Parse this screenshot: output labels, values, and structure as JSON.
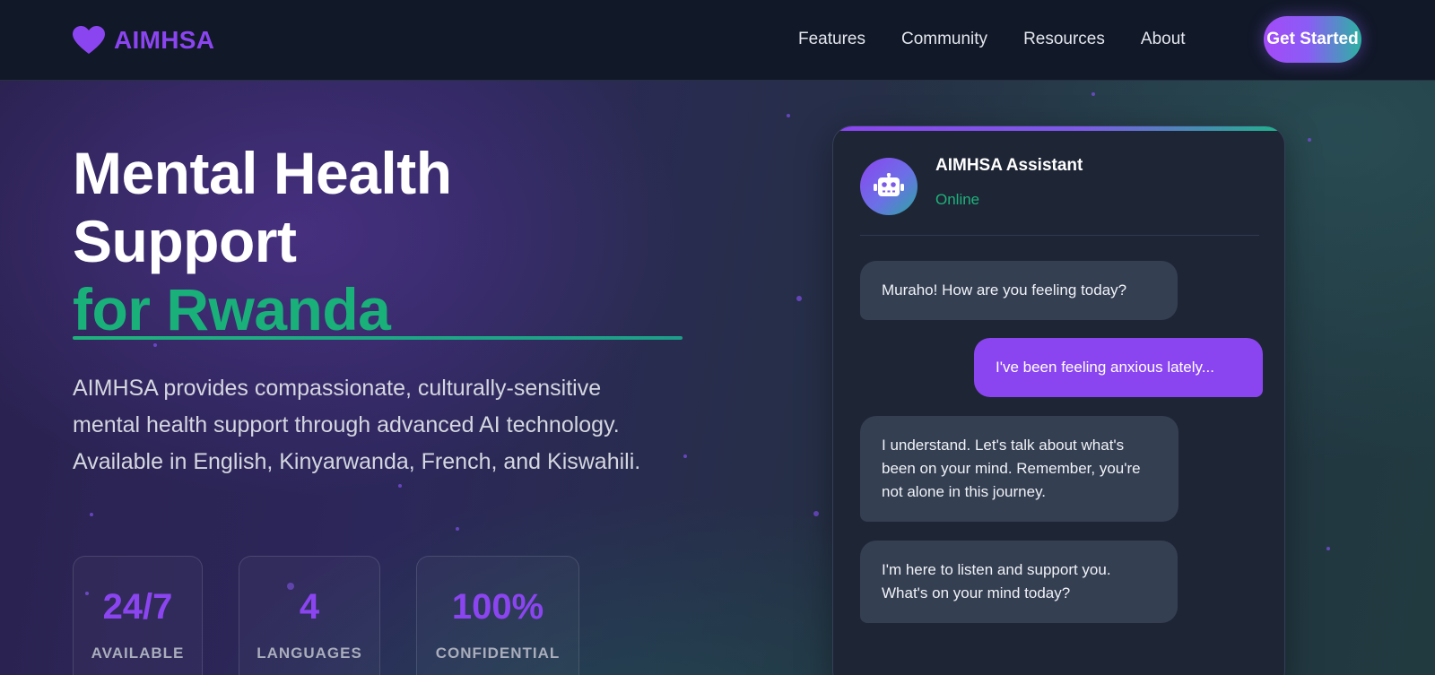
{
  "nav": {
    "brand": "AIMHSA",
    "links": [
      "Features",
      "Community",
      "Resources",
      "About"
    ],
    "cta": "Get Started"
  },
  "hero": {
    "title_line1": "Mental Health",
    "title_line2": "Support",
    "title_accent": "for Rwanda",
    "description": "AIMHSA provides compassionate, culturally-sensitive mental health support through advanced AI technology. Available in English, Kinyarwanda, French, and Kiswahili.",
    "stats": [
      {
        "value": "24/7",
        "label": "AVAILABLE"
      },
      {
        "value": "4",
        "label": "LANGUAGES"
      },
      {
        "value": "100%",
        "label": "CONFIDENTIAL"
      }
    ]
  },
  "chat": {
    "assistant_name": "AIMHSA Assistant",
    "status": "Online",
    "messages": [
      {
        "from": "bot",
        "text": "Muraho! How are you feeling today?"
      },
      {
        "from": "user",
        "text": "I've been feeling anxious lately..."
      },
      {
        "from": "bot",
        "text": "I understand. Let's talk about what's been on your mind. Remember, you're not alone in this journey."
      },
      {
        "from": "bot",
        "text": "I'm here to listen and support you. What's on your mind today?"
      }
    ]
  },
  "colors": {
    "brand_purple": "#8b45f0",
    "accent_green": "#19b07a",
    "nav_bg": "#111827",
    "card_bg": "#1e2535"
  },
  "icons": {
    "brand": "heart-icon",
    "avatar": "robot-icon"
  }
}
